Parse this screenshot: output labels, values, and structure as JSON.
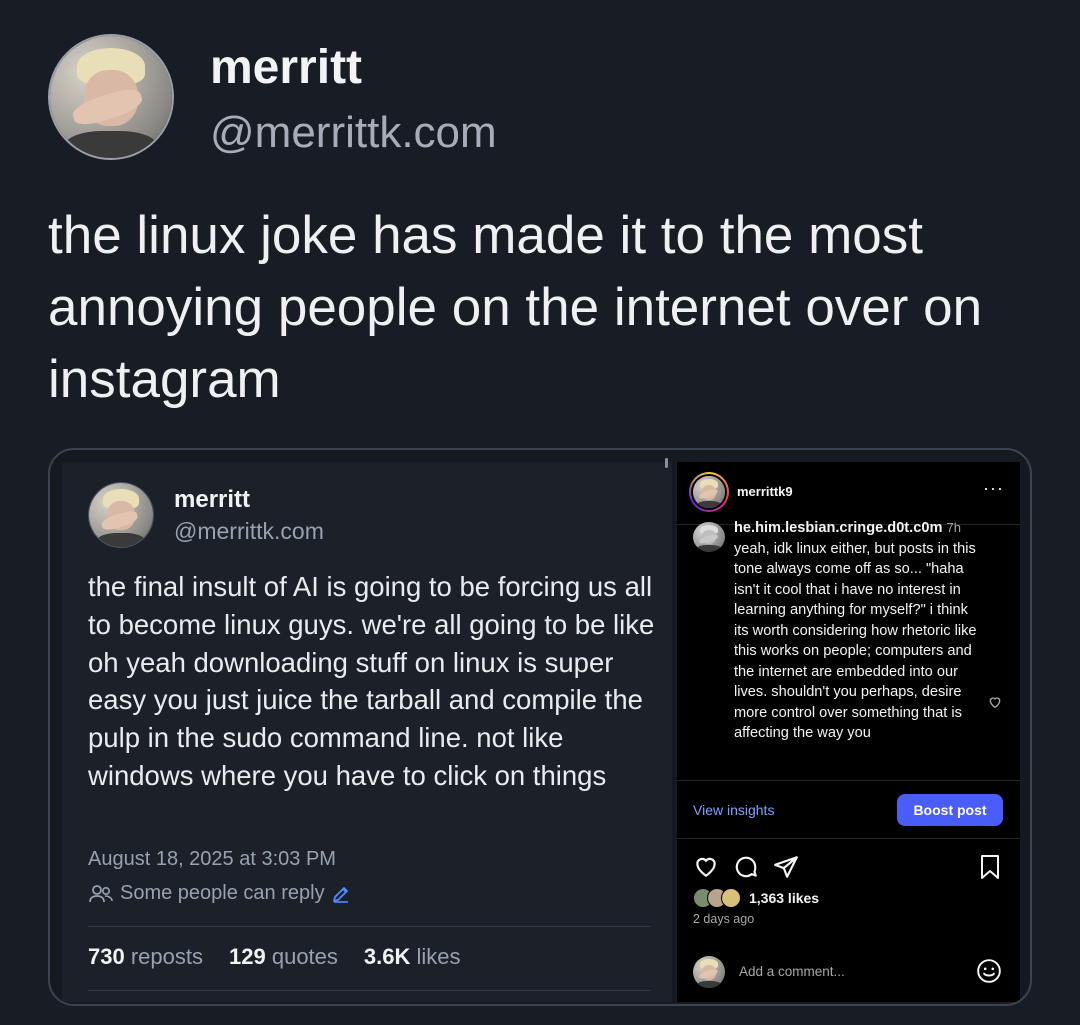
{
  "outer_post": {
    "name": "merritt",
    "handle": "@merrittk.com",
    "text": "the linux joke has made it to the most annoying people on the internet over on instagram"
  },
  "embedded_bsky": {
    "name": "merritt",
    "handle": "@merrittk.com",
    "text": "the final insult of AI is going to be forcing us all to become linux guys. we're all going to be like oh yeah downloading stuff on linux is super easy you just juice the tarball and compile the pulp in the sudo command line. not like windows where you have to click on things",
    "date": "August 18, 2025 at 3:03 PM",
    "reply_setting": "Some people can reply",
    "stats": {
      "reposts_count": "730",
      "reposts_label": "reposts",
      "quotes_count": "129",
      "quotes_label": "quotes",
      "likes_count": "3.6K",
      "likes_label": "likes"
    }
  },
  "instagram": {
    "username": "merrittk9",
    "more": "···",
    "comment": {
      "user": "he.him.lesbian.cringe.d0t.c0m",
      "time": "7h",
      "text": "yeah, idk linux either, but posts in this tone always come off as so... \"haha isn't it cool that i have no interest in learning anything for myself?\" i think its worth considering how rhetoric like this works on people; computers and the internet are embedded into our lives. shouldn't you perhaps, desire more control over something that is affecting the way you"
    },
    "view_insights": "View insights",
    "boost_post": "Boost post",
    "likes": "1,363 likes",
    "time_ago": "2 days ago",
    "add_comment": "Add a comment...",
    "icons": [
      "heart-icon",
      "comment-icon",
      "share-icon",
      "bookmark-icon",
      "emoji-icon"
    ]
  }
}
